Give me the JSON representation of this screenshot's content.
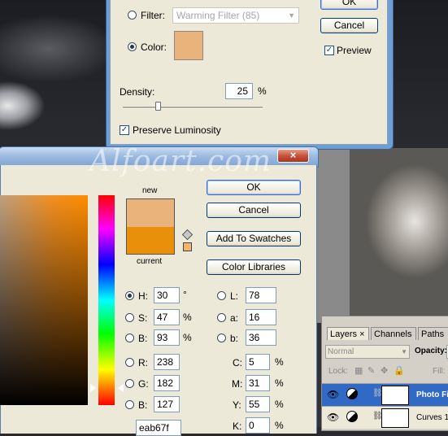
{
  "watermark": "Alfoart.com",
  "photo_filter": {
    "filter_label": "Filter:",
    "filter_value": "Warming Filter (85)",
    "color_label": "Color:",
    "color_swatch": "#eab37c",
    "ok_label": "OK",
    "cancel_label": "Cancel",
    "preview_label": "Preview",
    "density_label": "Density:",
    "density_value": "25",
    "density_unit": "%",
    "density_level_pct": 25,
    "preserve_label": "Preserve Luminosity"
  },
  "color_picker": {
    "close_glyph": "×",
    "new_label": "new",
    "current_label": "current",
    "new_color": "#eab37c",
    "current_color": "#e8900a",
    "ok_label": "OK",
    "cancel_label": "Cancel",
    "add_swatches_label": "Add To Swatches",
    "libraries_label": "Color Libraries",
    "hsb": {
      "h_label": "H:",
      "h_value": "30",
      "h_unit": "°",
      "s_label": "S:",
      "s_value": "47",
      "s_unit": "%",
      "b_label": "B:",
      "b_value": "93",
      "b_unit": "%"
    },
    "lab": {
      "l_label": "L:",
      "l_value": "78",
      "a_label": "a:",
      "a_value": "16",
      "b_label": "b:",
      "b_value": "36"
    },
    "rgb": {
      "r_label": "R:",
      "r_value": "238",
      "g_label": "G:",
      "g_value": "182",
      "b_label": "B:",
      "b_value": "127"
    },
    "cmyk": {
      "c_label": "C:",
      "c_value": "5",
      "c_unit": "%",
      "m_label": "M:",
      "m_value": "31",
      "m_unit": "%",
      "y_label": "Y:",
      "y_value": "55",
      "y_unit": "%",
      "k_label": "K:",
      "k_value": "0",
      "k_unit": "%"
    },
    "hex_partial": "eab67f"
  },
  "layers": {
    "tabs": [
      {
        "label": "Layers"
      },
      {
        "label": "Channels"
      },
      {
        "label": "Paths"
      }
    ],
    "tab_close": "×",
    "blend_mode": "Normal",
    "opacity_label": "Opacity:",
    "lock_label": "Lock:",
    "fill_label": "Fill:",
    "rows": [
      {
        "name": "Photo Fi"
      },
      {
        "name": "Curves 1"
      }
    ]
  }
}
